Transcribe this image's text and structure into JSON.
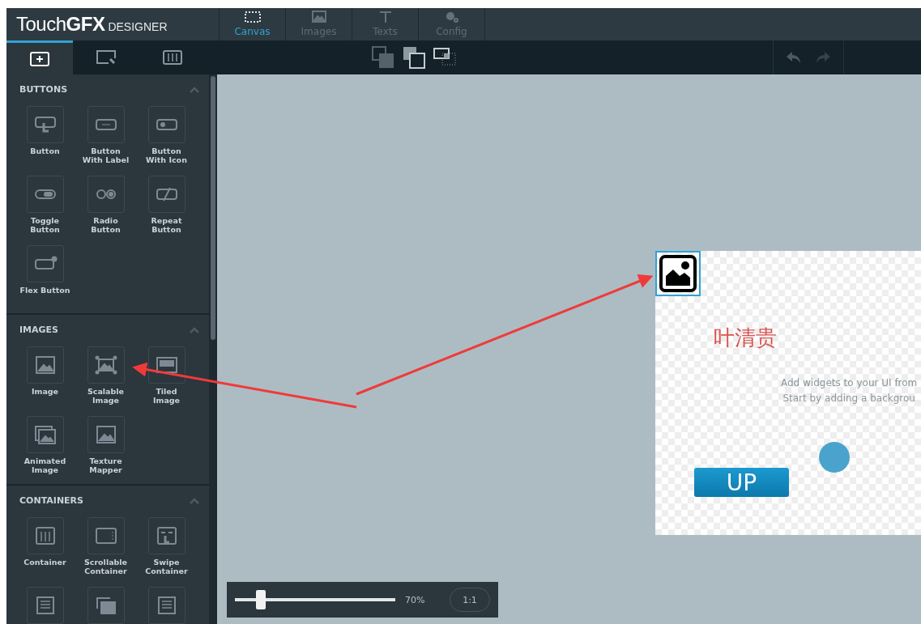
{
  "logo": {
    "text": "Touch**GFX**",
    "sub": "DESIGNER"
  },
  "nav_tabs": [
    {
      "label": "Canvas",
      "kind": "canvas",
      "selected": true
    },
    {
      "label": "Images",
      "kind": "images",
      "selected": false
    },
    {
      "label": "Texts",
      "kind": "texts",
      "selected": false
    },
    {
      "label": "Config",
      "kind": "config",
      "selected": false
    }
  ],
  "sidebar_tabs": [
    {
      "kind": "add",
      "selected": true
    },
    {
      "kind": "screen",
      "selected": false
    },
    {
      "kind": "sliders",
      "selected": false
    }
  ],
  "sections": [
    {
      "title": "BUTTONS",
      "expanded": true,
      "items": [
        {
          "label": "Button",
          "kind": "button"
        },
        {
          "label": "Button With Label",
          "kind": "label-button"
        },
        {
          "label": "Button With Icon",
          "kind": "icon-button"
        },
        {
          "label": "Toggle Button",
          "kind": "toggle"
        },
        {
          "label": "Radio Button",
          "kind": "radio"
        },
        {
          "label": "Repeat Button",
          "kind": "repeat"
        },
        {
          "label": "Flex Button",
          "kind": "flex"
        }
      ]
    },
    {
      "title": "IMAGES",
      "expanded": true,
      "items": [
        {
          "label": "Image",
          "kind": "image"
        },
        {
          "label": "Scalable Image",
          "kind": "scalable"
        },
        {
          "label": "Tiled Image",
          "kind": "tiled"
        },
        {
          "label": "Animated Image",
          "kind": "animated"
        },
        {
          "label": "Texture Mapper",
          "kind": "texture"
        }
      ]
    },
    {
      "title": "CONTAINERS",
      "expanded": true,
      "items": [
        {
          "label": "Container",
          "kind": "container"
        },
        {
          "label": "Scrollable Container",
          "kind": "scrollable"
        },
        {
          "label": "Swipe Container",
          "kind": "swipe"
        },
        {
          "kind": "list"
        },
        {
          "kind": "stack"
        },
        {
          "kind": "list"
        }
      ]
    }
  ],
  "canvas": {
    "name_text": "叶清贵",
    "hint_lines": [
      "Add widgets to your UI from",
      "Start by adding a backgrou"
    ],
    "button_label": "UP",
    "image_selected": true
  },
  "zoom": {
    "level": 0.16,
    "reading": "70%",
    "reset": "1:1"
  }
}
